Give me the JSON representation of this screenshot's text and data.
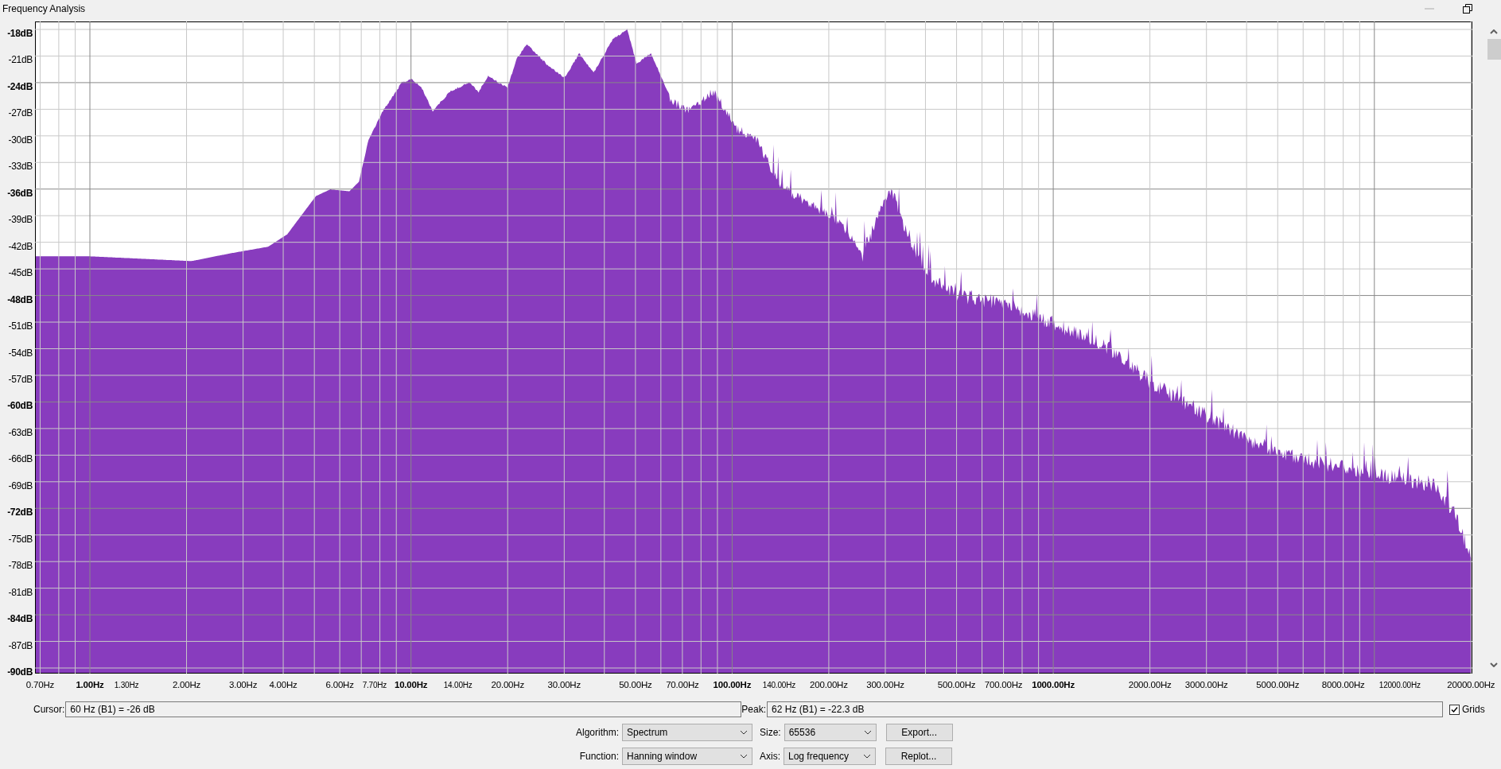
{
  "window": {
    "title": "Frequency Analysis"
  },
  "plot": {
    "y_axis_labels": [
      "-18dB",
      "-21dB",
      "-24dB",
      "-27dB",
      "-30dB",
      "-33dB",
      "-36dB",
      "-39dB",
      "-42dB",
      "-45dB",
      "-48dB",
      "-51dB",
      "-54dB",
      "-57dB",
      "-60dB",
      "-63dB",
      "-66dB",
      "-69dB",
      "-72dB",
      "-75dB",
      "-78dB",
      "-81dB",
      "-84dB",
      "-87dB",
      "-90dB"
    ],
    "x_axis_labels": [
      "0.70Hz",
      "1.00Hz",
      "1.30Hz",
      "2.00Hz",
      "3.00Hz",
      "4.00Hz",
      "6.00Hz",
      "7.70Hz",
      "10.00Hz",
      "14.00Hz",
      "20.00Hz",
      "30.00Hz",
      "50.00Hz",
      "70.00Hz",
      "100.00Hz",
      "140.00Hz",
      "200.00Hz",
      "300.00Hz",
      "500.00Hz",
      "700.00Hz",
      "1000.00Hz",
      "2000.00Hz",
      "3000.00Hz",
      "5000.00Hz",
      "8000.00Hz",
      "12000.00Hz",
      "20000.00Hz"
    ]
  },
  "cursor": {
    "label": "Cursor:",
    "value": "60 Hz (B1) = -26 dB"
  },
  "peak": {
    "label": "Peak:",
    "value": "62 Hz (B1) = -22.3 dB"
  },
  "grids": {
    "label": "Grids",
    "checked": true
  },
  "algorithm": {
    "label": "Algorithm:",
    "value": "Spectrum"
  },
  "size": {
    "label": "Size:",
    "value": "65536"
  },
  "function": {
    "label": "Function:",
    "value": "Hanning window"
  },
  "axis": {
    "label": "Axis:",
    "value": "Log frequency"
  },
  "buttons": [
    "Export...",
    "Replot..."
  ]
}
